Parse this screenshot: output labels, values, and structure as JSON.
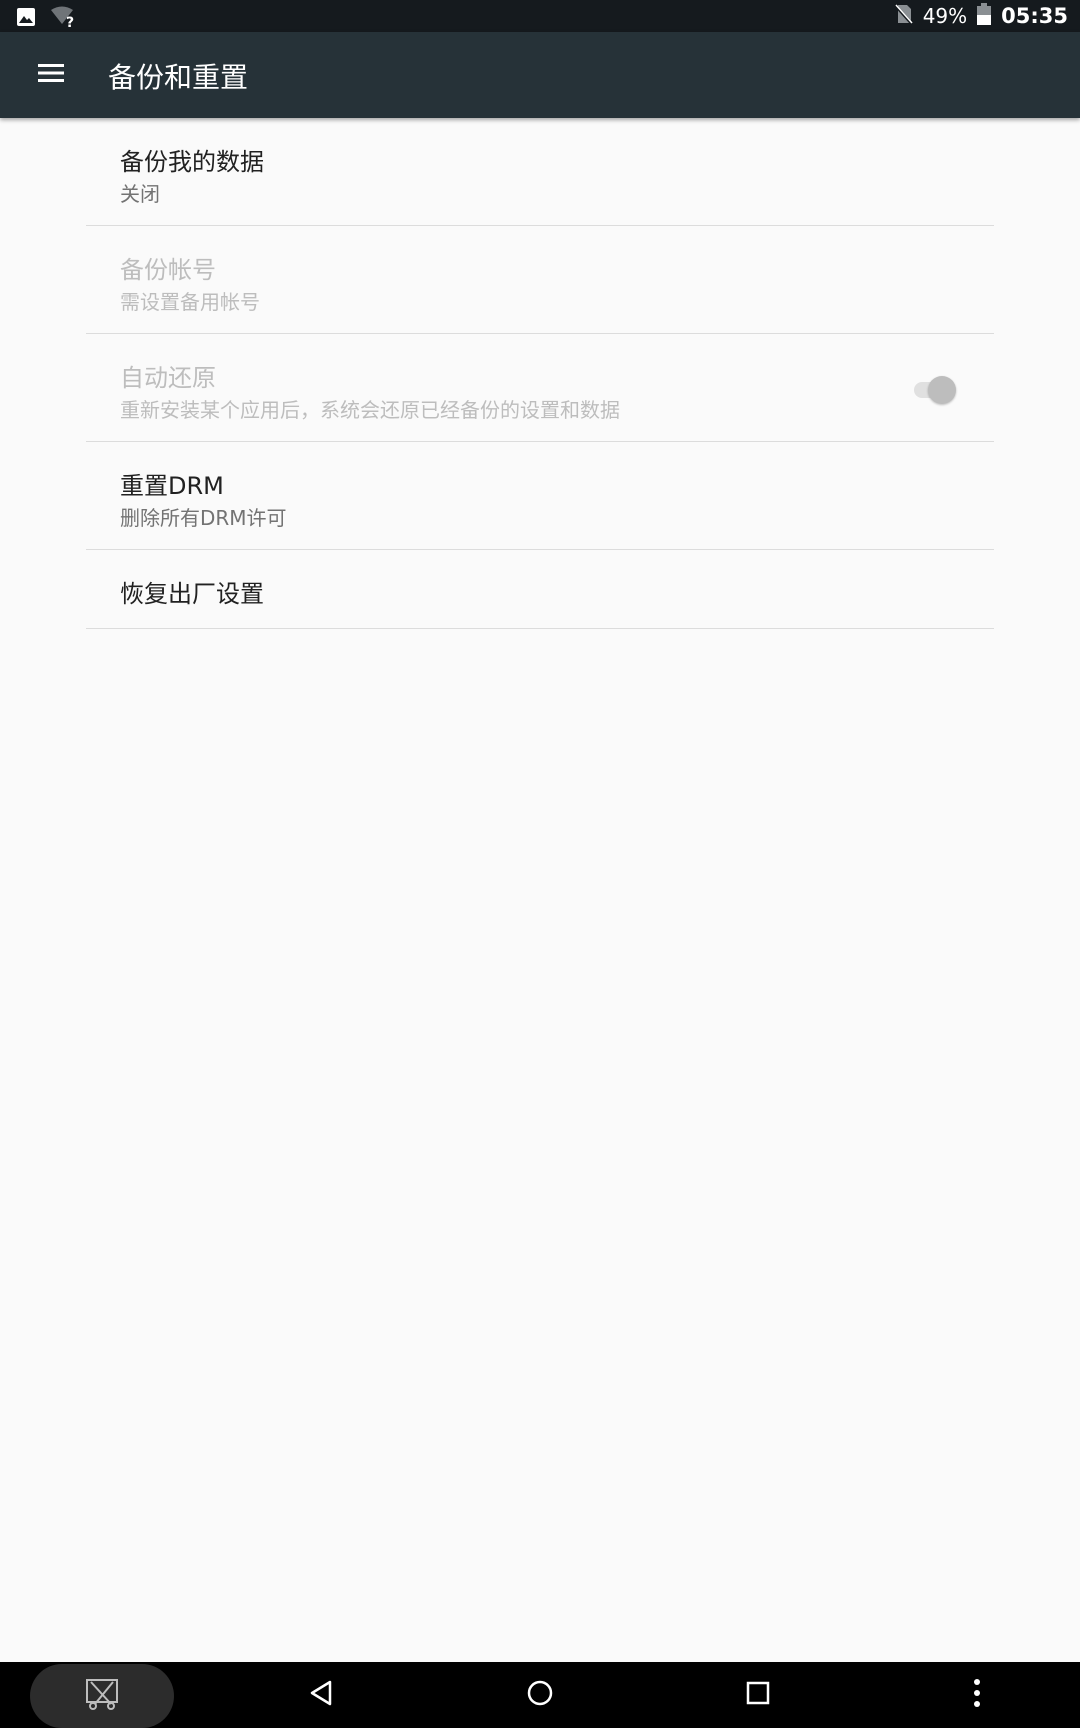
{
  "status_bar": {
    "battery_percent": "49%",
    "time": "05:35",
    "icons": [
      "image-notification-icon",
      "wifi-unknown-icon",
      "no-sim-icon",
      "battery-icon"
    ]
  },
  "toolbar": {
    "title": "备份和重置",
    "menu_icon": "menu-icon"
  },
  "items": [
    {
      "title": "备份我的数据",
      "summary": "关闭",
      "enabled": true
    },
    {
      "title": "备份帐号",
      "summary": "需设置备用帐号",
      "enabled": false
    },
    {
      "title": "自动还原",
      "summary": "重新安装某个应用后，系统会还原已经备份的设置和数据",
      "enabled": false,
      "switch_on": true
    },
    {
      "title": "重置DRM",
      "summary": "删除所有DRM许可",
      "enabled": true
    },
    {
      "title": "恢复出厂设置",
      "enabled": true
    }
  ],
  "nav_bar": {
    "icons": [
      "screenshot-icon",
      "back-icon",
      "home-icon",
      "recents-icon",
      "more-icon"
    ]
  },
  "colors": {
    "status_bar": "#151a1e",
    "toolbar": "#263238",
    "background": "#fafafa",
    "divider": "#dcdcdc"
  }
}
